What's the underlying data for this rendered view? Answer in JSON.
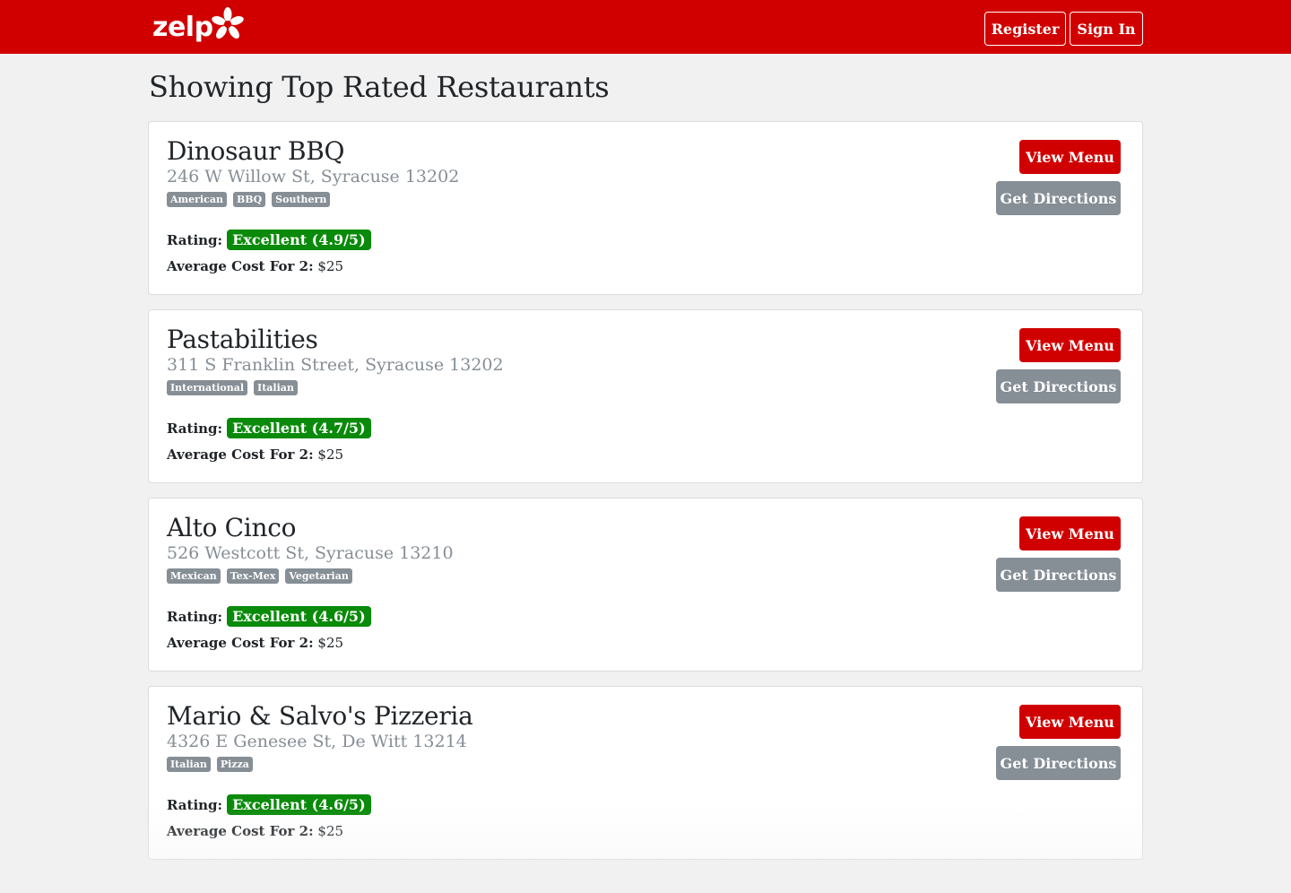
{
  "header": {
    "logo_text": "zelp",
    "register_label": "Register",
    "signin_label": "Sign In",
    "brand_color": "#d10000"
  },
  "page": {
    "title": "Showing Top Rated Restaurants"
  },
  "labels": {
    "rating": "Rating:",
    "avg_cost": "Average Cost For 2:",
    "view_menu": "View Menu",
    "get_directions": "Get Directions"
  },
  "restaurants": [
    {
      "name": "Dinosaur BBQ",
      "address": "246 W Willow St, Syracuse 13202",
      "tags": [
        "American",
        "BBQ",
        "Southern"
      ],
      "rating": "Excellent (4.9/5)",
      "cost": "$25"
    },
    {
      "name": "Pastabilities",
      "address": "311 S Franklin Street, Syracuse 13202",
      "tags": [
        "International",
        "Italian"
      ],
      "rating": "Excellent (4.7/5)",
      "cost": "$25"
    },
    {
      "name": "Alto Cinco",
      "address": "526 Westcott St, Syracuse 13210",
      "tags": [
        "Mexican",
        "Tex-Mex",
        "Vegetarian"
      ],
      "rating": "Excellent (4.6/5)",
      "cost": "$25"
    },
    {
      "name": "Mario & Salvo's Pizzeria",
      "address": "4326 E Genesee St, De Witt 13214",
      "tags": [
        "Italian",
        "Pizza"
      ],
      "rating": "Excellent (4.6/5)",
      "cost": "$25"
    }
  ]
}
